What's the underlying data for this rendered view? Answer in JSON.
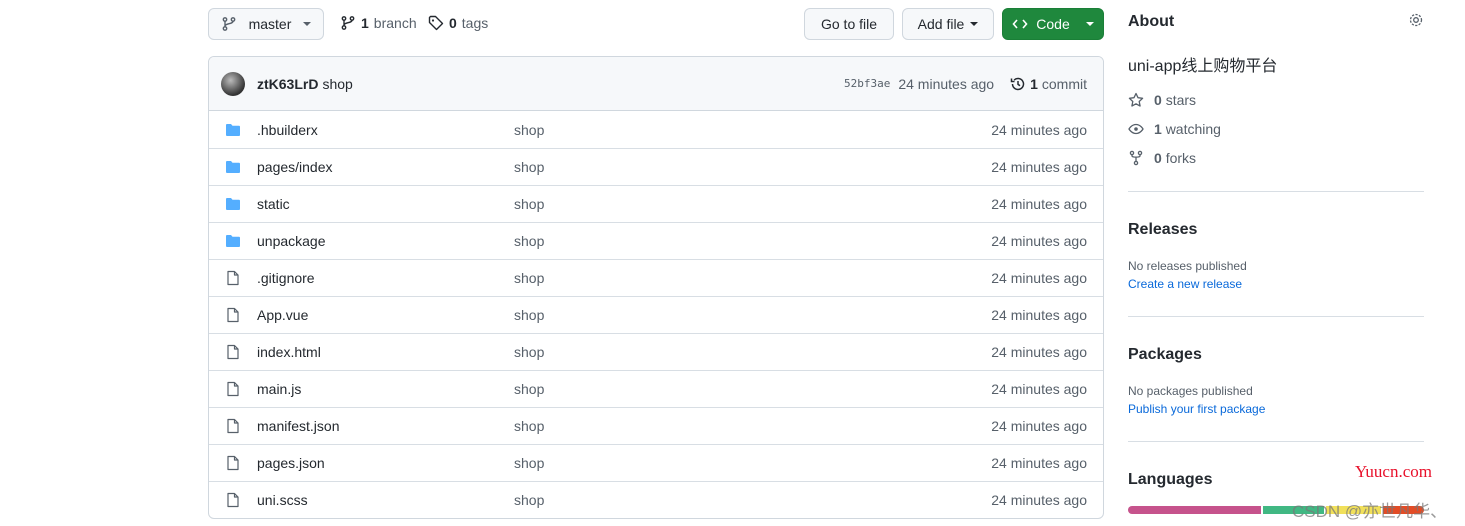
{
  "branch_select": {
    "label": "master"
  },
  "branches": {
    "count": "1",
    "label": "branch"
  },
  "tags": {
    "count": "0",
    "label": "tags"
  },
  "buttons": {
    "go_to_file": "Go to file",
    "add_file": "Add file",
    "code": "Code"
  },
  "commit": {
    "author": "ztK63LrD",
    "message": "shop",
    "sha": "52bf3ae",
    "age": "24 minutes ago",
    "count": "1",
    "count_label": "commit"
  },
  "files": [
    {
      "name": ".hbuilderx",
      "type": "folder",
      "message": "shop",
      "age": "24 minutes ago"
    },
    {
      "name": "pages/index",
      "type": "folder",
      "message": "shop",
      "age": "24 minutes ago"
    },
    {
      "name": "static",
      "type": "folder",
      "message": "shop",
      "age": "24 minutes ago"
    },
    {
      "name": "unpackage",
      "type": "folder",
      "message": "shop",
      "age": "24 minutes ago"
    },
    {
      "name": ".gitignore",
      "type": "file",
      "message": "shop",
      "age": "24 minutes ago"
    },
    {
      "name": "App.vue",
      "type": "file",
      "message": "shop",
      "age": "24 minutes ago"
    },
    {
      "name": "index.html",
      "type": "file",
      "message": "shop",
      "age": "24 minutes ago"
    },
    {
      "name": "main.js",
      "type": "file",
      "message": "shop",
      "age": "24 minutes ago"
    },
    {
      "name": "manifest.json",
      "type": "file",
      "message": "shop",
      "age": "24 minutes ago"
    },
    {
      "name": "pages.json",
      "type": "file",
      "message": "shop",
      "age": "24 minutes ago"
    },
    {
      "name": "uni.scss",
      "type": "file",
      "message": "shop",
      "age": "24 minutes ago"
    }
  ],
  "about": {
    "title": "About",
    "description": "uni-app线上购物平台",
    "stars": {
      "count": "0",
      "label": "stars"
    },
    "watching": {
      "count": "1",
      "label": "watching"
    },
    "forks": {
      "count": "0",
      "label": "forks"
    }
  },
  "releases": {
    "title": "Releases",
    "empty": "No releases published",
    "link": "Create a new release"
  },
  "packages": {
    "title": "Packages",
    "empty": "No packages published",
    "link": "Publish your first package"
  },
  "languages": {
    "title": "Languages",
    "segments": [
      {
        "percent": 46,
        "color": "#c6538c"
      },
      {
        "percent": 21,
        "color": "#41b883"
      },
      {
        "percent": 19,
        "color": "#f1e05a"
      },
      {
        "percent": 14,
        "color": "#e34c26"
      }
    ]
  },
  "colors": {
    "accent": "#1f883d",
    "folder": "#54aeff",
    "link": "#0969da"
  },
  "watermark": {
    "site": "Yuucn.com",
    "csdn": "CSDN @亦世凡华、"
  }
}
